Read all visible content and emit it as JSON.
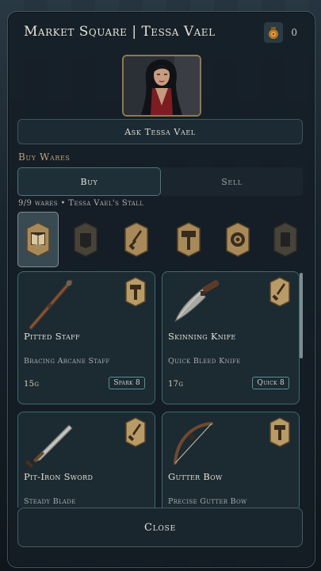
{
  "header": {
    "title": "Market Square | Tessa Vael",
    "coin_icon": "coin-pouch-icon",
    "coin_count": "0"
  },
  "merchant": {
    "ask_label": "Ask Tessa Vael"
  },
  "section": {
    "label": "Buy Wares"
  },
  "tabs": [
    {
      "label": "Buy",
      "active": true
    },
    {
      "label": "Sell",
      "active": false
    }
  ],
  "wares_info": "9/9 wares • Tessa Vael's Stall",
  "filters": [
    {
      "icon": "tome-icon",
      "selected": true
    },
    {
      "icon": "armor-icon",
      "selected": false
    },
    {
      "icon": "dagger-icon",
      "selected": false
    },
    {
      "icon": "hammer-icon",
      "selected": false
    },
    {
      "icon": "shield-icon",
      "selected": false
    },
    {
      "icon": "misc-icon",
      "selected": false
    }
  ],
  "items": [
    {
      "name": "Pitted Staff",
      "subtitle": "Bracing Arcane Staff",
      "price": "15g",
      "tag": "Spark 8",
      "icon": "staff-icon",
      "badge": "hammer-badge-icon"
    },
    {
      "name": "Skinning Knife",
      "subtitle": "Quick Bleed Knife",
      "price": "17g",
      "tag": "Quick 8",
      "icon": "knife-icon",
      "badge": "dagger-badge-icon"
    },
    {
      "name": "Pit-Iron Sword",
      "subtitle": "Steady Blade",
      "price": "",
      "tag": "",
      "icon": "sword-icon",
      "badge": "dagger-badge-icon"
    },
    {
      "name": "Gutter Bow",
      "subtitle": "Precise Gutter Bow",
      "price": "",
      "tag": "",
      "icon": "bow-icon",
      "badge": "hammer-badge-icon"
    }
  ],
  "close_label": "Close"
}
